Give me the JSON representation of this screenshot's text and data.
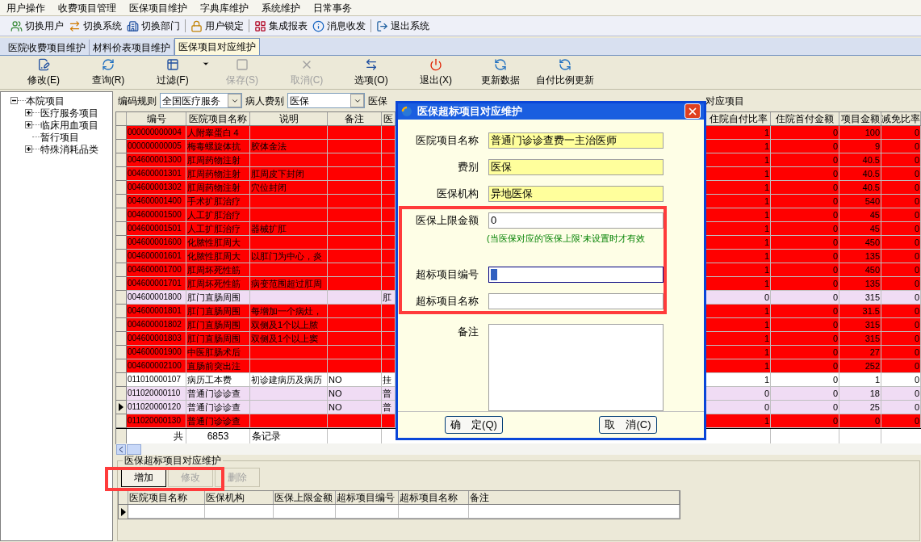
{
  "menu": [
    "用户操作",
    "收费项目管理",
    "医保项目维护",
    "字典库维护",
    "系统维护",
    "日常事务"
  ],
  "toolbar_groups": [
    [
      "切换用户",
      "切换系统",
      "切换部门"
    ],
    [
      "用户锁定"
    ],
    [
      "集成报表",
      "消息收发"
    ],
    [
      "退出系统"
    ]
  ],
  "tabs": [
    {
      "label": "医院收费项目维护",
      "selected": false
    },
    {
      "label": "材料价表项目维护",
      "selected": false
    },
    {
      "label": "医保项目对应维护",
      "selected": true
    }
  ],
  "actions": [
    {
      "label": "修改(E)",
      "disabled": false,
      "dropdown": false
    },
    {
      "label": "查询(R)",
      "disabled": false,
      "dropdown": false
    },
    {
      "label": "过滤(F)",
      "disabled": false,
      "dropdown": true
    },
    {
      "label": "保存(S)",
      "disabled": true,
      "dropdown": false
    },
    {
      "label": "取消(C)",
      "disabled": true,
      "dropdown": false
    },
    {
      "label": "选项(O)",
      "disabled": false,
      "dropdown": false
    },
    {
      "label": "退出(X)",
      "disabled": false,
      "dropdown": false
    },
    {
      "label": "更新数据",
      "disabled": false,
      "dropdown": false
    },
    {
      "label": "自付比例更新",
      "disabled": false,
      "dropdown": false
    }
  ],
  "tree": {
    "label": "本院项目",
    "expanded": true,
    "children": [
      {
        "label": "医疗服务项目",
        "kind": "folder",
        "expanded": false
      },
      {
        "label": "临床用血项目",
        "kind": "folder",
        "expanded": false
      },
      {
        "label": "暂行项目",
        "kind": "leaf"
      },
      {
        "label": "特殊消耗品类",
        "kind": "folder",
        "expanded": false
      }
    ]
  },
  "filter": {
    "coding_rule": {
      "label": "编码规则",
      "value": "全国医疗服务"
    },
    "patient_fee": {
      "label": "病人费别",
      "value": "医保"
    },
    "insurance_label": "医保",
    "right_text": "对应项目"
  },
  "table": {
    "columns_left": [
      "编号",
      "医院项目名称",
      "说明",
      "备注",
      "医"
    ],
    "columns_right": [
      "住院自付比率",
      "住院首付金额",
      "项目金额",
      "减免比率"
    ],
    "rows": [
      {
        "code": "000000000004",
        "name": "人附睾蛋白４",
        "self_ratio": "1",
        "first_pay": "0",
        "amount": "100",
        "discount": "0",
        "color": "#ff0000",
        "selected": false
      },
      {
        "code": "000000000005",
        "name": "梅毒螺旋体抗",
        "description": "胶体金法",
        "self_ratio": "1",
        "first_pay": "0",
        "amount": "9",
        "discount": "0",
        "color": "#ff0000",
        "selected": false
      },
      {
        "code": "004600001300",
        "name": "肛周药物注射",
        "self_ratio": "1",
        "first_pay": "0",
        "amount": "40.5",
        "discount": "0",
        "color": "#ff0000",
        "selected": false
      },
      {
        "code": "004600001301",
        "name": "肛周药物注射",
        "description": "肛周皮下封闭",
        "self_ratio": "1",
        "first_pay": "0",
        "amount": "40.5",
        "discount": "0",
        "color": "#ff0000",
        "selected": false
      },
      {
        "code": "004600001302",
        "name": "肛周药物注射",
        "description": "穴位封闭",
        "self_ratio": "1",
        "first_pay": "0",
        "amount": "40.5",
        "discount": "0",
        "color": "#ff0000",
        "selected": false
      },
      {
        "code": "004600001400",
        "name": "手术扩肛治疗",
        "self_ratio": "1",
        "first_pay": "0",
        "amount": "540",
        "discount": "0",
        "color": "#ff0000",
        "selected": false
      },
      {
        "code": "004600001500",
        "name": "人工扩肛治疗",
        "self_ratio": "1",
        "first_pay": "0",
        "amount": "45",
        "discount": "0",
        "color": "#ff0000",
        "selected": false
      },
      {
        "code": "004600001501",
        "name": "人工扩肛治疗",
        "description": "器械扩肛",
        "self_ratio": "1",
        "first_pay": "0",
        "amount": "45",
        "discount": "0",
        "color": "#ff0000",
        "selected": false
      },
      {
        "code": "004600001600",
        "name": "化脓性肛周大",
        "self_ratio": "1",
        "first_pay": "0",
        "amount": "450",
        "discount": "0",
        "color": "#ff0000",
        "selected": false
      },
      {
        "code": "004600001601",
        "name": "化脓性肛周大",
        "description": "以肛门为中心，炎",
        "self_ratio": "1",
        "first_pay": "0",
        "amount": "135",
        "discount": "0",
        "color": "#ff0000",
        "selected": false
      },
      {
        "code": "004600001700",
        "name": "肛周坏死性筋",
        "self_ratio": "1",
        "first_pay": "0",
        "amount": "450",
        "discount": "0",
        "color": "#ff0000",
        "selected": false
      },
      {
        "code": "004600001701",
        "name": "肛周坏死性筋",
        "description": "病变范围超过肛周",
        "self_ratio": "1",
        "first_pay": "0",
        "amount": "135",
        "discount": "0",
        "color": "#ff0000",
        "selected": false
      },
      {
        "code": "004600001800",
        "name": "肛门直肠周围",
        "column_5": "肛",
        "self_ratio": "0",
        "first_pay": "0",
        "amount": "315",
        "discount": "0",
        "color": "#f0dcf4",
        "selected": false
      },
      {
        "code": "004600001801",
        "name": "肛门直肠周围",
        "description": "每增加一个病灶，",
        "self_ratio": "1",
        "first_pay": "0",
        "amount": "31.5",
        "discount": "0",
        "color": "#ff0000",
        "selected": false
      },
      {
        "code": "004600001802",
        "name": "肛门直肠周围",
        "description": "双侧及1个以上脓",
        "self_ratio": "1",
        "first_pay": "0",
        "amount": "315",
        "discount": "0",
        "color": "#ff0000",
        "selected": false
      },
      {
        "code": "004600001803",
        "name": "肛门直肠周围",
        "description": "双侧及1个以上窦",
        "self_ratio": "1",
        "first_pay": "0",
        "amount": "315",
        "discount": "0",
        "color": "#ff0000",
        "selected": false
      },
      {
        "code": "004600001900",
        "name": "中医肛肠术后",
        "self_ratio": "1",
        "first_pay": "0",
        "amount": "27",
        "discount": "0",
        "color": "#ff0000",
        "selected": false
      },
      {
        "code": "004600002100",
        "name": "直肠前突出注",
        "self_ratio": "1",
        "first_pay": "0",
        "amount": "252",
        "discount": "0",
        "color": "#ff0000",
        "selected": false
      },
      {
        "code": "011010000107",
        "name": "病历工本费",
        "description": "初诊建病历及病历",
        "remark": "NO",
        "column_5": "挂",
        "self_ratio": "1",
        "first_pay": "0",
        "amount": "1",
        "discount": "0",
        "color": "#ffffff",
        "selected": false
      },
      {
        "code": "011020000110",
        "name": "普通门诊诊查",
        "remark": "NO",
        "column_5": "普",
        "self_ratio": "0",
        "first_pay": "0",
        "amount": "18",
        "discount": "0",
        "color": "#f0dcf4",
        "selected": false
      },
      {
        "code": "011020000120",
        "name": "普通门诊诊查",
        "remark": "NO",
        "column_5": "普",
        "self_ratio": "0",
        "first_pay": "0",
        "amount": "25",
        "discount": "0",
        "color": "#f0dcf4",
        "selected": true
      },
      {
        "code": "011020000130",
        "name": "普通门诊诊查",
        "self_ratio": "1",
        "first_pay": "0",
        "amount": "0",
        "discount": "0",
        "color": "#ff0000",
        "selected": false
      }
    ],
    "footer": {
      "label": "共",
      "count": "6853",
      "unit": "条记录"
    }
  },
  "dialog": {
    "title": "医保超标项目对应维护",
    "fields": [
      {
        "label": "医院项目名称",
        "value": "普通门诊诊查费一主治医师",
        "kind": "readonly",
        "focused": false
      },
      {
        "label": "费别",
        "value": "医保",
        "kind": "readonly",
        "focused": false
      },
      {
        "label": "医保机构",
        "value": "异地医保",
        "kind": "readonly",
        "focused": false
      },
      {
        "label": "医保上限金额",
        "value": "0",
        "kind": "input",
        "focused": false,
        "hint": "(当医保对应的’医保上限’未设置时才有效"
      },
      {
        "label": "超标项目编号",
        "kind": "input",
        "focused": true
      },
      {
        "label": "超标项目名称",
        "kind": "input",
        "focused": false
      },
      {
        "label": "备注",
        "kind": "textarea"
      }
    ],
    "buttons": [
      "确　定(Q)",
      "取　消(C)"
    ]
  },
  "bottom": {
    "title": "医保超标项目对应维护",
    "buttons": [
      {
        "label": "增加",
        "disabled": false
      },
      {
        "label": "修改",
        "disabled": true
      },
      {
        "label": "删除",
        "disabled": true
      }
    ],
    "columns": [
      "医院项目名称",
      "医保机构",
      "医保上限金额",
      "超标项目编号",
      "超标项目名称",
      "备注"
    ]
  }
}
